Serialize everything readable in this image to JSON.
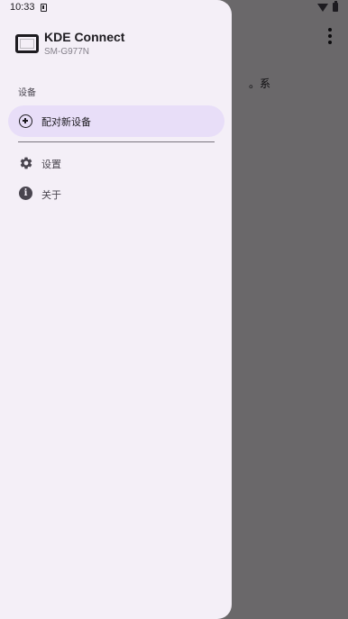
{
  "status_bar": {
    "time": "10:33"
  },
  "drawer": {
    "app_name": "KDE Connect",
    "device_name": "SM-G977N",
    "section_label": "设备",
    "pair_new_device": "配对新设备",
    "settings": "设置",
    "about": "关于"
  },
  "background": {
    "partial_text": "系。"
  },
  "colors": {
    "drawer_bg": "#f4eff7",
    "selected_item_bg": "#e8def8",
    "scrim": "#6d6a71",
    "text_primary": "#1d1b20",
    "text_secondary": "#85818b"
  },
  "icons": {
    "header": "device-monitor-icon",
    "pair": "add-circle-icon",
    "settings": "gear-icon",
    "about": "info-icon"
  }
}
